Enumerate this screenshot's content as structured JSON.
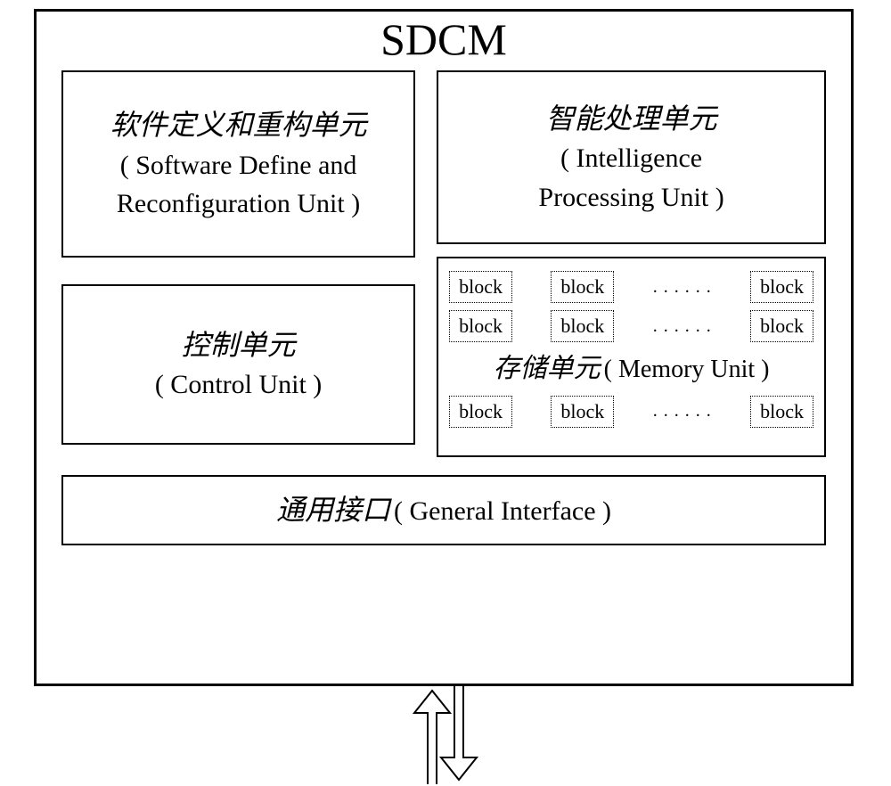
{
  "title": "SDCM",
  "sdru": {
    "cn": "软件定义和重构单元",
    "en1": "( Software Define and",
    "en2": "Reconfiguration Unit )"
  },
  "control": {
    "cn": "控制单元",
    "en": "( Control Unit )"
  },
  "ipu": {
    "cn": "智能处理单元",
    "en1": "( Intelligence",
    "en2": "Processing Unit )"
  },
  "memory": {
    "block_label": "block",
    "dots": ". . . . . .",
    "label_cn": "存储单元",
    "label_en": "( Memory Unit )"
  },
  "general_interface": {
    "cn": "通用接口",
    "en": "( General Interface )"
  }
}
